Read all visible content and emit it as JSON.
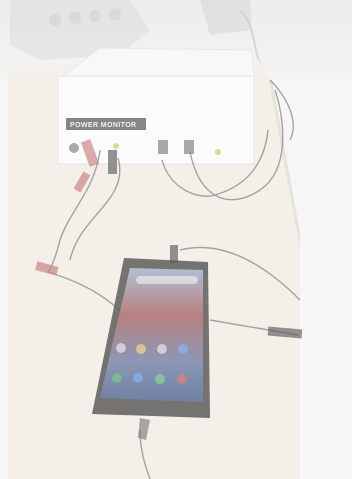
{
  "device": {
    "label": "POWER MONITOR"
  },
  "colors": {
    "background": "#f4f4f4",
    "table": "#f2ede4",
    "box": "#fafafa",
    "label_bg": "#3c3c3c",
    "led": "#b8e07a",
    "cable": "#666666",
    "clip_red": "#c06a6a",
    "clip_black": "#444444",
    "phone_body": "#3a3a3a",
    "phone_screen_top": "#b64a45",
    "phone_screen_bottom": "#5b74a6"
  }
}
